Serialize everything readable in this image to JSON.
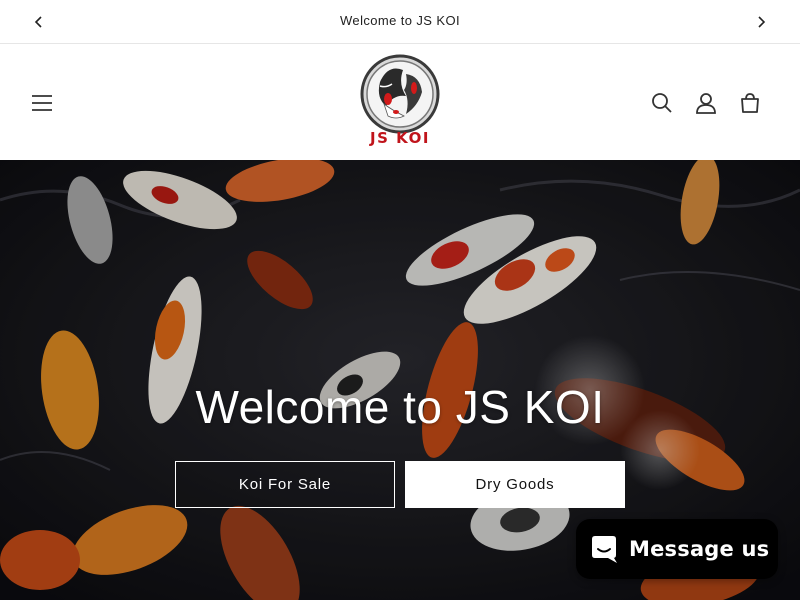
{
  "announcement": {
    "message": "Welcome to JS KOI",
    "prev_icon": "chevron-left-icon",
    "next_icon": "chevron-right-icon"
  },
  "header": {
    "menu_icon": "hamburger-menu-icon",
    "logo_text": "JS KOI",
    "search_icon": "search-icon",
    "account_icon": "user-icon",
    "cart_icon": "shopping-bag-icon"
  },
  "hero": {
    "title": "Welcome to JS KOI",
    "primary_button": "Koi For Sale",
    "secondary_button": "Dry Goods"
  },
  "chat": {
    "label": "Message us",
    "icon": "chat-bubble-icon"
  },
  "colors": {
    "brand_red": "#c0141b",
    "chat_bg": "#000000",
    "text": "#121212"
  }
}
